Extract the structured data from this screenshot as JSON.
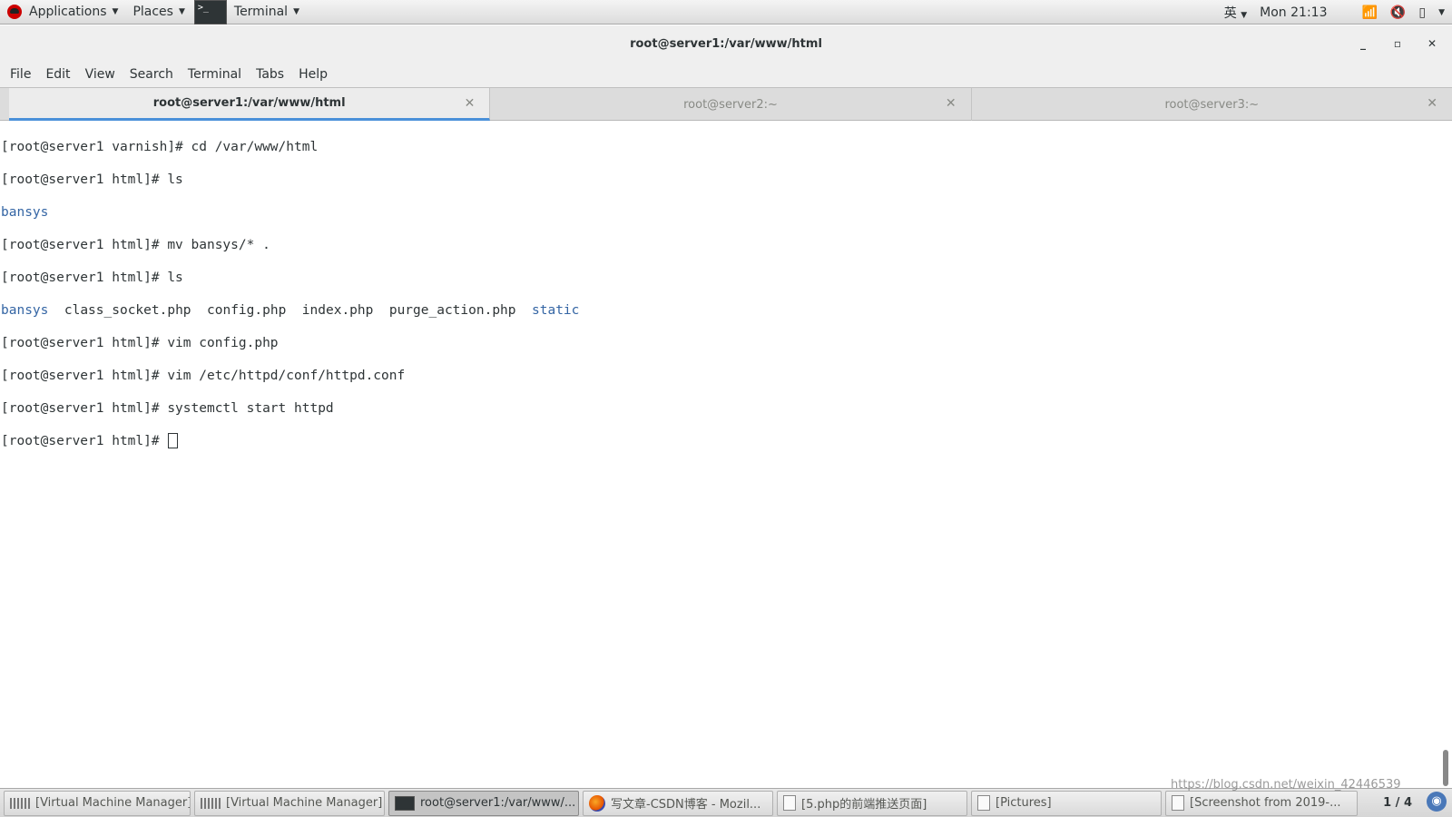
{
  "top_panel": {
    "applications_label": "Applications",
    "places_label": "Places",
    "terminal_label": "Terminal",
    "input_method": "英",
    "clock": "Mon 21:13"
  },
  "window": {
    "title": "root@server1:/var/www/html",
    "minimize_icon": "_",
    "maximize_icon": "▫",
    "close_icon": "✕"
  },
  "menu": {
    "items": [
      "File",
      "Edit",
      "View",
      "Search",
      "Terminal",
      "Tabs",
      "Help"
    ]
  },
  "tabs": [
    {
      "label": "root@server1:/var/www/html",
      "active": true
    },
    {
      "label": "root@server2:~",
      "active": false
    },
    {
      "label": "root@server3:~",
      "active": false
    }
  ],
  "terminal": {
    "lines": [
      "[root@server1 varnish]# cd /var/www/html",
      "[root@server1 html]# ls",
      "bansys",
      "[root@server1 html]# mv bansys/* .",
      "[root@server1 html]# ls",
      "LS_OUTPUT",
      "[root@server1 html]# vim config.php",
      "[root@server1 html]# vim /etc/httpd/conf/httpd.conf",
      "[root@server1 html]# systemctl start httpd",
      "[root@server1 html]# "
    ],
    "ls_output": {
      "dir1": "bansys",
      "file1": "class_socket.php",
      "file2": "config.php",
      "file3": "index.php",
      "file4": "purge_action.php",
      "dir2": "static"
    },
    "directory_color": "#3465a4"
  },
  "taskbar": {
    "items": [
      {
        "label": "[Virtual Machine Manager]",
        "icon": "vm-icon",
        "active": false
      },
      {
        "label": "[Virtual Machine Manager]",
        "icon": "vm-icon",
        "active": false
      },
      {
        "label": "root@server1:/var/www/...",
        "icon": "terminal-icon",
        "active": true
      },
      {
        "label": "写文章-CSDN博客 - Mozil...",
        "icon": "firefox-icon",
        "active": false
      },
      {
        "label": "[5.php的前端推送页面]",
        "icon": "document-icon",
        "active": false
      },
      {
        "label": "[Pictures]",
        "icon": "document-icon",
        "active": false
      },
      {
        "label": "[Screenshot from 2019-...",
        "icon": "document-icon",
        "active": false
      }
    ],
    "workspace": "1 / 4",
    "watermark": "https://blog.csdn.net/weixin_42446539"
  }
}
